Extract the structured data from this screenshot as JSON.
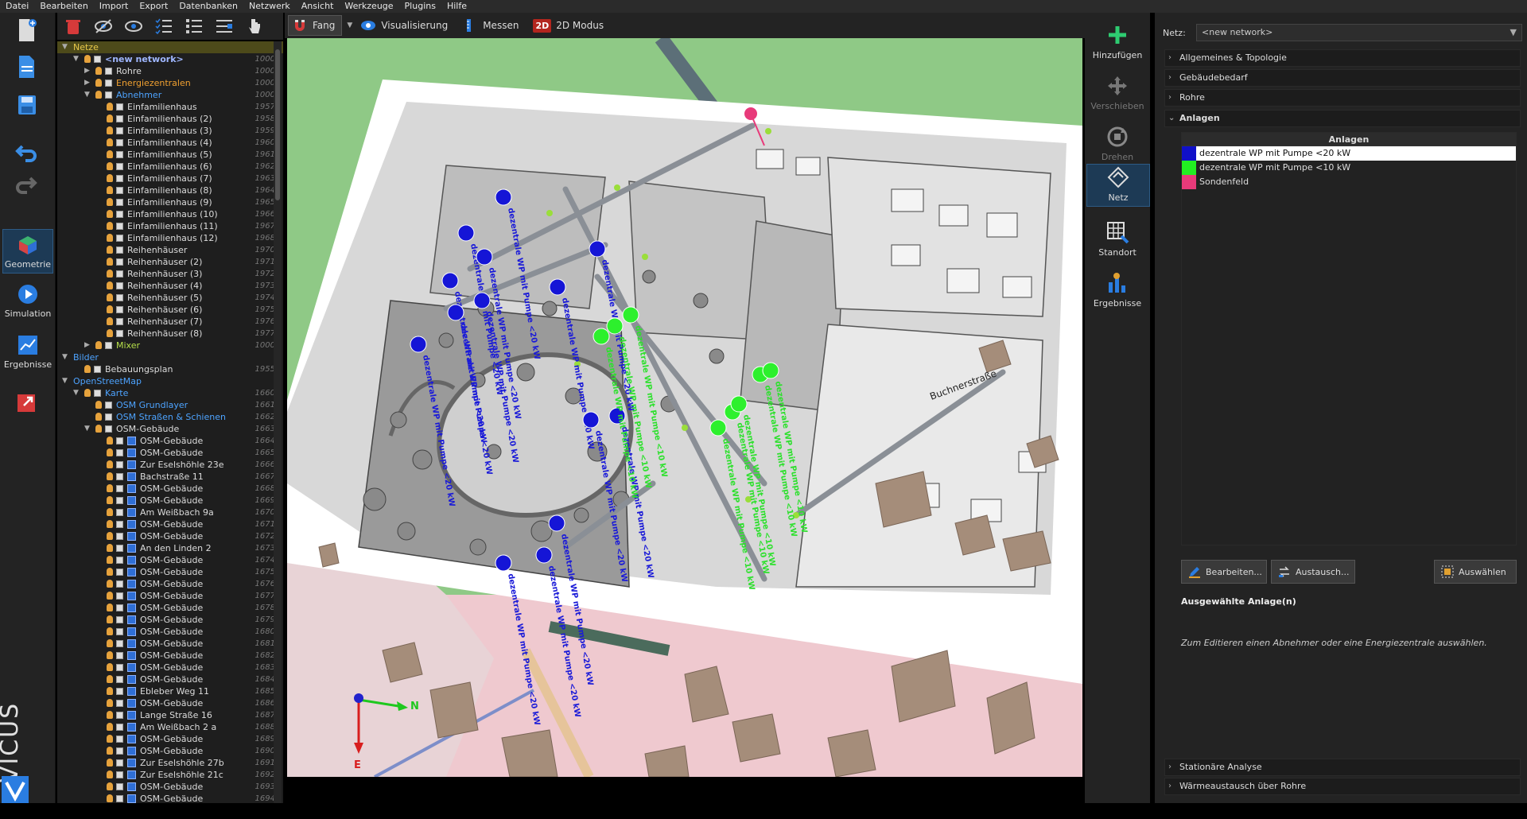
{
  "menu": [
    "Datei",
    "Bearbeiten",
    "Import",
    "Export",
    "Datenbanken",
    "Netzwerk",
    "Ansicht",
    "Werkzeuge",
    "Plugins",
    "Hilfe"
  ],
  "modes": {
    "geometry": "Geometrie",
    "simulation": "Simulation",
    "results": "Ergebnisse"
  },
  "brand": "VICUS",
  "view_toolbar": {
    "snap": "Fang",
    "visualization": "Visualisierung",
    "measure": "Messen",
    "mode_2d": "2D Modus",
    "mode_2d_badge": "2D"
  },
  "tools": {
    "add": "Hinzufügen",
    "move": "Verschieben",
    "rotate": "Drehen",
    "network": "Netz",
    "location": "Standort",
    "results": "Ergebnisse"
  },
  "tree": [
    {
      "arrow": "▼",
      "indent": 0,
      "label": "Netze",
      "id": "",
      "type": "header",
      "sel": true
    },
    {
      "arrow": "▼",
      "indent": 1,
      "label": "<new network>",
      "id": "1000",
      "type": "network"
    },
    {
      "arrow": "▶",
      "indent": 2,
      "label": "Rohre",
      "id": "1000",
      "type": "plain"
    },
    {
      "arrow": "▶",
      "indent": 2,
      "label": "Energiezentralen",
      "id": "1000",
      "type": "orange"
    },
    {
      "arrow": "▼",
      "indent": 2,
      "label": "Abnehmer",
      "id": "1000",
      "type": "blue"
    },
    {
      "arrow": "",
      "indent": 3,
      "label": "Einfamilienhaus",
      "id": "1957",
      "type": "item"
    },
    {
      "arrow": "",
      "indent": 3,
      "label": "Einfamilienhaus (2)",
      "id": "1958",
      "type": "item"
    },
    {
      "arrow": "",
      "indent": 3,
      "label": "Einfamilienhaus (3)",
      "id": "1959",
      "type": "item"
    },
    {
      "arrow": "",
      "indent": 3,
      "label": "Einfamilienhaus (4)",
      "id": "1960",
      "type": "item"
    },
    {
      "arrow": "",
      "indent": 3,
      "label": "Einfamilienhaus (5)",
      "id": "1961",
      "type": "item"
    },
    {
      "arrow": "",
      "indent": 3,
      "label": "Einfamilienhaus (6)",
      "id": "1962",
      "type": "item"
    },
    {
      "arrow": "",
      "indent": 3,
      "label": "Einfamilienhaus (7)",
      "id": "1963",
      "type": "item"
    },
    {
      "arrow": "",
      "indent": 3,
      "label": "Einfamilienhaus (8)",
      "id": "1964",
      "type": "item"
    },
    {
      "arrow": "",
      "indent": 3,
      "label": "Einfamilienhaus (9)",
      "id": "1965",
      "type": "item"
    },
    {
      "arrow": "",
      "indent": 3,
      "label": "Einfamilienhaus (10)",
      "id": "1966",
      "type": "item"
    },
    {
      "arrow": "",
      "indent": 3,
      "label": "Einfamilienhaus (11)",
      "id": "1967",
      "type": "item"
    },
    {
      "arrow": "",
      "indent": 3,
      "label": "Einfamilienhaus (12)",
      "id": "1968",
      "type": "item"
    },
    {
      "arrow": "",
      "indent": 3,
      "label": "Reihenhäuser",
      "id": "1970",
      "type": "item"
    },
    {
      "arrow": "",
      "indent": 3,
      "label": "Reihenhäuser (2)",
      "id": "1971",
      "type": "item"
    },
    {
      "arrow": "",
      "indent": 3,
      "label": "Reihenhäuser (3)",
      "id": "1972",
      "type": "item"
    },
    {
      "arrow": "",
      "indent": 3,
      "label": "Reihenhäuser (4)",
      "id": "1973",
      "type": "item"
    },
    {
      "arrow": "",
      "indent": 3,
      "label": "Reihenhäuser (5)",
      "id": "1974",
      "type": "item"
    },
    {
      "arrow": "",
      "indent": 3,
      "label": "Reihenhäuser (6)",
      "id": "1975",
      "type": "item"
    },
    {
      "arrow": "",
      "indent": 3,
      "label": "Reihenhäuser (7)",
      "id": "1976",
      "type": "item"
    },
    {
      "arrow": "",
      "indent": 3,
      "label": "Reihenhäuser (8)",
      "id": "1977",
      "type": "item"
    },
    {
      "arrow": "▶",
      "indent": 2,
      "label": "Mixer",
      "id": "1000",
      "type": "green"
    },
    {
      "arrow": "▼",
      "indent": 0,
      "label": "Bilder",
      "id": "",
      "type": "cat"
    },
    {
      "arrow": "",
      "indent": 1,
      "label": "Bebauungsplan",
      "id": "1955",
      "type": "item"
    },
    {
      "arrow": "▼",
      "indent": 0,
      "label": "OpenStreetMap",
      "id": "",
      "type": "cat"
    },
    {
      "arrow": "▼",
      "indent": 1,
      "label": "Karte",
      "id": "1660",
      "type": "blueitem"
    },
    {
      "arrow": "",
      "indent": 2,
      "label": "OSM Grundlayer",
      "id": "1661",
      "type": "bluelink"
    },
    {
      "arrow": "",
      "indent": 2,
      "label": "OSM Straßen & Schienen",
      "id": "1662",
      "type": "bluelink"
    },
    {
      "arrow": "▼",
      "indent": 2,
      "label": "OSM-Gebäude",
      "id": "1663",
      "type": "item"
    },
    {
      "arrow": "",
      "indent": 3,
      "label": "OSM-Gebäude",
      "id": "1664",
      "type": "bldg"
    },
    {
      "arrow": "",
      "indent": 3,
      "label": "OSM-Gebäude",
      "id": "1665",
      "type": "bldg"
    },
    {
      "arrow": "",
      "indent": 3,
      "label": "Zur Eselshöhle 23e",
      "id": "1666",
      "type": "bldg"
    },
    {
      "arrow": "",
      "indent": 3,
      "label": "Bachstraße 11",
      "id": "1667",
      "type": "bldg"
    },
    {
      "arrow": "",
      "indent": 3,
      "label": "OSM-Gebäude",
      "id": "1668",
      "type": "bldg"
    },
    {
      "arrow": "",
      "indent": 3,
      "label": "OSM-Gebäude",
      "id": "1669",
      "type": "bldg"
    },
    {
      "arrow": "",
      "indent": 3,
      "label": "Am Weißbach 9a",
      "id": "1670",
      "type": "bldg"
    },
    {
      "arrow": "",
      "indent": 3,
      "label": "OSM-Gebäude",
      "id": "1671",
      "type": "bldg"
    },
    {
      "arrow": "",
      "indent": 3,
      "label": "OSM-Gebäude",
      "id": "1672",
      "type": "bldg"
    },
    {
      "arrow": "",
      "indent": 3,
      "label": "An den Linden 2",
      "id": "1673",
      "type": "bldg"
    },
    {
      "arrow": "",
      "indent": 3,
      "label": "OSM-Gebäude",
      "id": "1674",
      "type": "bldg"
    },
    {
      "arrow": "",
      "indent": 3,
      "label": "OSM-Gebäude",
      "id": "1675",
      "type": "bldg"
    },
    {
      "arrow": "",
      "indent": 3,
      "label": "OSM-Gebäude",
      "id": "1676",
      "type": "bldg"
    },
    {
      "arrow": "",
      "indent": 3,
      "label": "OSM-Gebäude",
      "id": "1677",
      "type": "bldg"
    },
    {
      "arrow": "",
      "indent": 3,
      "label": "OSM-Gebäude",
      "id": "1678",
      "type": "bldg"
    },
    {
      "arrow": "",
      "indent": 3,
      "label": "OSM-Gebäude",
      "id": "1679",
      "type": "bldg"
    },
    {
      "arrow": "",
      "indent": 3,
      "label": "OSM-Gebäude",
      "id": "1680",
      "type": "bldg"
    },
    {
      "arrow": "",
      "indent": 3,
      "label": "OSM-Gebäude",
      "id": "1681",
      "type": "bldg"
    },
    {
      "arrow": "",
      "indent": 3,
      "label": "OSM-Gebäude",
      "id": "1682",
      "type": "bldg"
    },
    {
      "arrow": "",
      "indent": 3,
      "label": "OSM-Gebäude",
      "id": "1683",
      "type": "bldg"
    },
    {
      "arrow": "",
      "indent": 3,
      "label": "OSM-Gebäude",
      "id": "1684",
      "type": "bldg"
    },
    {
      "arrow": "",
      "indent": 3,
      "label": "Ebleber Weg 11",
      "id": "1685",
      "type": "bldg"
    },
    {
      "arrow": "",
      "indent": 3,
      "label": "OSM-Gebäude",
      "id": "1686",
      "type": "bldg"
    },
    {
      "arrow": "",
      "indent": 3,
      "label": "Lange Straße 16",
      "id": "1687",
      "type": "bldg"
    },
    {
      "arrow": "",
      "indent": 3,
      "label": "Am Weißbach 2 a",
      "id": "1688",
      "type": "bldg"
    },
    {
      "arrow": "",
      "indent": 3,
      "label": "OSM-Gebäude",
      "id": "1689",
      "type": "bldg"
    },
    {
      "arrow": "",
      "indent": 3,
      "label": "OSM-Gebäude",
      "id": "1690",
      "type": "bldg"
    },
    {
      "arrow": "",
      "indent": 3,
      "label": "Zur Eselshöhle 27b",
      "id": "1691",
      "type": "bldg"
    },
    {
      "arrow": "",
      "indent": 3,
      "label": "Zur Eselshöhle 21c",
      "id": "1692",
      "type": "bldg"
    },
    {
      "arrow": "",
      "indent": 3,
      "label": "OSM-Gebäude",
      "id": "1693",
      "type": "bldg"
    },
    {
      "arrow": "",
      "indent": 3,
      "label": "OSM-Gebäude",
      "id": "1694",
      "type": "bldg"
    }
  ],
  "scene": {
    "label_blue": "dezentrale WP mit Pumpe <20 kW",
    "label_green": "dezentrale WP mit Pumpe <10 kW",
    "street_label": "Buchnerstraße",
    "axis_n": "N",
    "axis_e": "E"
  },
  "props": {
    "netz_label": "Netz:",
    "netz_value": "<new network>",
    "sections": {
      "general": "Allgemeines & Topologie",
      "demand": "Gebäudebedarf",
      "pipes": "Rohre",
      "plants": "Anlagen",
      "steady": "Stationäre Analyse",
      "heat_exchange": "Wärmeaustausch über Rohre"
    },
    "table_header": "Anlagen",
    "plants": [
      {
        "label": "dezentrale WP mit Pumpe <20 kW",
        "color": "#1010c8",
        "selected": true
      },
      {
        "label": "dezentrale WP mit Pumpe <10 kW",
        "color": "#22ee22",
        "selected": false
      },
      {
        "label": "Sondenfeld",
        "color": "#e83a7a",
        "selected": false
      }
    ],
    "buttons": {
      "edit": "Bearbeiten...",
      "exchange": "Austausch...",
      "select": "Auswählen"
    },
    "selected_title": "Ausgewählte Anlage(n)",
    "selected_hint": "Zum Editieren einen Abnehmer oder eine Energiezentrale auswählen."
  }
}
